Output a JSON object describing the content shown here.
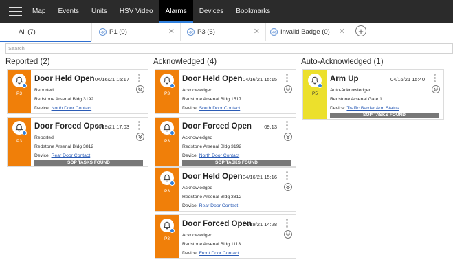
{
  "nav": {
    "items": [
      {
        "label": "Map",
        "active": false
      },
      {
        "label": "Events",
        "active": false
      },
      {
        "label": "Units",
        "active": false
      },
      {
        "label": "HSV Video",
        "active": false
      },
      {
        "label": "Alarms",
        "active": true
      },
      {
        "label": "Devices",
        "active": false
      },
      {
        "label": "Bookmarks",
        "active": false
      }
    ],
    "accent_color": "#2f7fdc"
  },
  "tabs": [
    {
      "label": "All (7)",
      "closable": false
    },
    {
      "label": "P1 (0)",
      "icon": "alarm-filter-icon",
      "closable": true
    },
    {
      "label": "P3 (6)",
      "icon": "alarm-filter-icon",
      "closable": true
    },
    {
      "label": "Invalid Badge (0)",
      "icon": "alarm-filter-icon",
      "closable": true
    }
  ],
  "search": {
    "placeholder": "Search"
  },
  "columns": [
    {
      "title": "Reported (2)",
      "cards": [
        {
          "title": "Door Held Open",
          "date": "04/16/21 15:17",
          "status": "Reported",
          "location": "Redstone Arsenal Bldg 3192",
          "device_label": "Device:",
          "device": "North Door Contact",
          "priority": "P3",
          "stripe_color": "#f07f09",
          "sop": ""
        },
        {
          "title": "Door Forced Open",
          "date": "04/19/21 17:03",
          "status": "Reported",
          "location": "Redstone Arsenal Bldg 3812",
          "device_label": "Device:",
          "device": "Rear Door Contact",
          "priority": "P3",
          "stripe_color": "#f07f09",
          "sop": "SOP TASKS FOUND"
        }
      ]
    },
    {
      "title": "Acknowledged (4)",
      "cards": [
        {
          "title": "Door Held Open",
          "date": "04/16/21 15:15",
          "status": "Acknowledged",
          "location": "Redstone Arsenal Bldg 1517",
          "device_label": "Device:",
          "device": "South Door Contact",
          "priority": "P3",
          "stripe_color": "#f07f09",
          "sop": ""
        },
        {
          "title": "Door Forced Open",
          "date": "09:13",
          "status": "Acknowledged",
          "location": "Redstone Arsenal Bldg 3192",
          "device_label": "Device:",
          "device": "North Door Contact",
          "priority": "P3",
          "stripe_color": "#f07f09",
          "sop": "SOP TASKS FOUND"
        },
        {
          "title": "Door Held Open",
          "date": "04/16/21 15:16",
          "status": "Acknowledged",
          "location": "Redstone Arsenal Bldg 3812",
          "device_label": "Device:",
          "device": "Rear Door Contact",
          "priority": "P3",
          "stripe_color": "#f07f09",
          "sop": ""
        },
        {
          "title": "Door Forced Open",
          "date": "04/19/21 14:28",
          "status": "Acknowledged",
          "location": "Redstone Arsenal Bldg 1113",
          "device_label": "Device:",
          "device": "Front Door Contact",
          "priority": "P3",
          "stripe_color": "#f07f09",
          "sop": ""
        }
      ]
    },
    {
      "title": "Auto-Acknowledged (1)",
      "cards": [
        {
          "title": "Arm Up",
          "date": "04/16/21 15:40",
          "status": "Auto-Acknowledged",
          "location": "Redstone Arsenal Gate 1",
          "device_label": "Device:",
          "device": "Traffic Barrier Arm Status",
          "priority": "P5",
          "stripe_color": "#ece02c",
          "sop": "SOP TASKS FOUND"
        }
      ]
    }
  ]
}
